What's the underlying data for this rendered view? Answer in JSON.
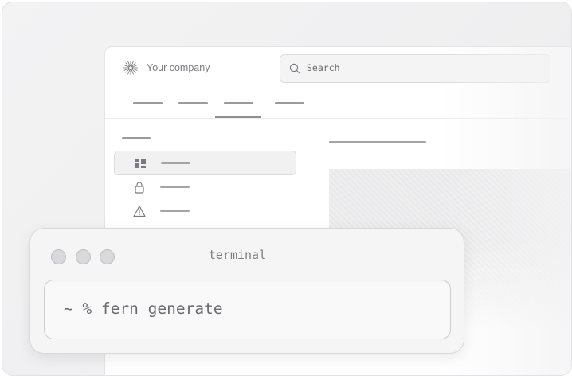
{
  "app": {
    "company_name": "Your company",
    "logo_icon": "sunburst-logo-icon",
    "search": {
      "placeholder": "Search",
      "icon": "search-icon"
    },
    "nav_tabs_count": 4,
    "sidebar": {
      "items": [
        {
          "icon": "dashboard-icon",
          "active": true
        },
        {
          "icon": "lock-icon",
          "active": false
        },
        {
          "icon": "warning-icon",
          "active": false
        }
      ]
    }
  },
  "terminal": {
    "title": "terminal",
    "command": "~ % fern generate",
    "window_dots": [
      "close-dot",
      "minimize-dot",
      "maximize-dot"
    ]
  },
  "colors": {
    "background": "#efeff0",
    "terminal_bg": "#f5f5f6",
    "text_muted": "#7a7a80"
  }
}
